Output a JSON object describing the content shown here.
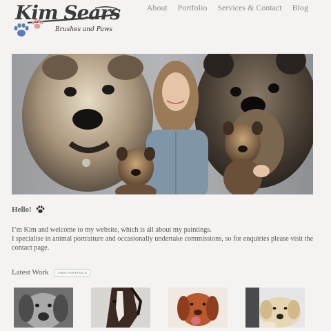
{
  "logo": {
    "title": "Kim Sears",
    "tagline": "Brushes and Paws",
    "paw_colors": [
      "#5b7fb0",
      "#e39aa0"
    ],
    "icon": "paw-print-icon"
  },
  "nav": {
    "items": [
      "About",
      "Portfolio",
      "Services & Contact",
      "Blog"
    ]
  },
  "hero": {
    "alt": "Painting of two border terriers with a woman holding two puppies"
  },
  "greeting": {
    "text": "Hello!",
    "icon": "paw-print-icon"
  },
  "intro": {
    "line1": "I’m Kim and welcome to my website, which is all about my paintings.",
    "line2": "I specialise in animal portraiture and occasionally undertake commissions, so for enquiries please visit the contact page."
  },
  "latest": {
    "title": "Latest Work",
    "button": "VIEW PORTFOLIO"
  },
  "thumbnails": [
    {
      "icon": "dog-portrait-icon"
    },
    {
      "icon": "horse-portrait-icon"
    },
    {
      "icon": "dog-portrait-icon"
    },
    {
      "icon": "dog-portrait-icon"
    }
  ],
  "colors": {
    "background": "#f4f3f1",
    "nav_text": "#8a8a8a",
    "body_text": "#555555"
  }
}
